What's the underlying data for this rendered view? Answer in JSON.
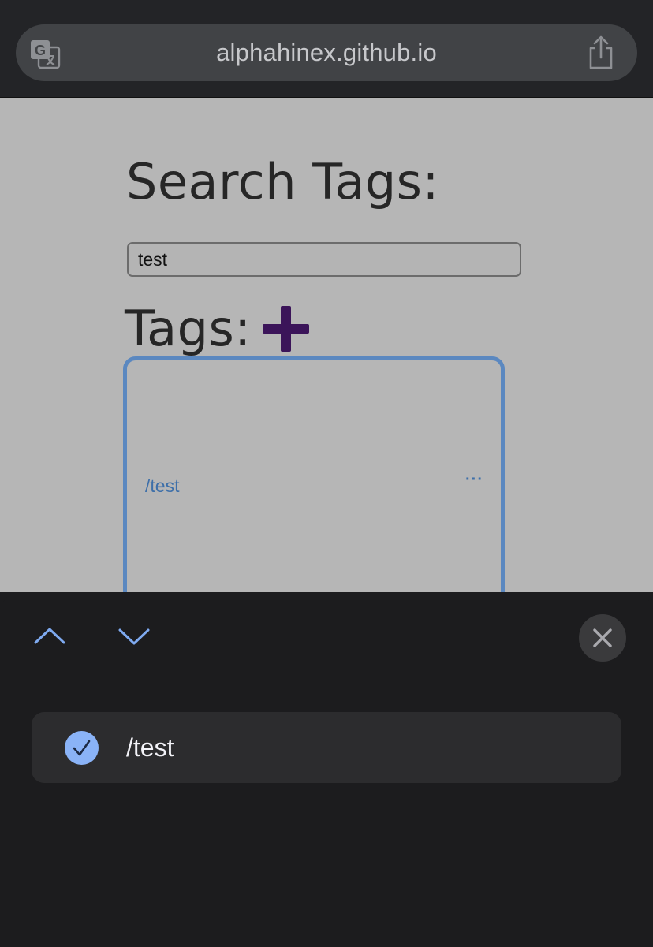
{
  "browser": {
    "url": "alphahinex.github.io",
    "translate_icon": "translate-icon",
    "share_icon": "share-icon"
  },
  "page": {
    "title": "Search Tags:",
    "search": {
      "value": "test",
      "placeholder": ""
    },
    "tags_heading": "Tags:",
    "add_icon": "plus-icon",
    "tag_card": {
      "tag": "/test",
      "more": "···"
    }
  },
  "find_sheet": {
    "up_icon": "chevron-up-icon",
    "down_icon": "chevron-down-icon",
    "close_icon": "close-icon",
    "results": [
      {
        "text": "/test",
        "selected": true
      }
    ],
    "colors": {
      "accent": "#8ab3f7",
      "sheet_bg": "#1c1c1e",
      "row_bg": "#2c2c2e"
    }
  }
}
